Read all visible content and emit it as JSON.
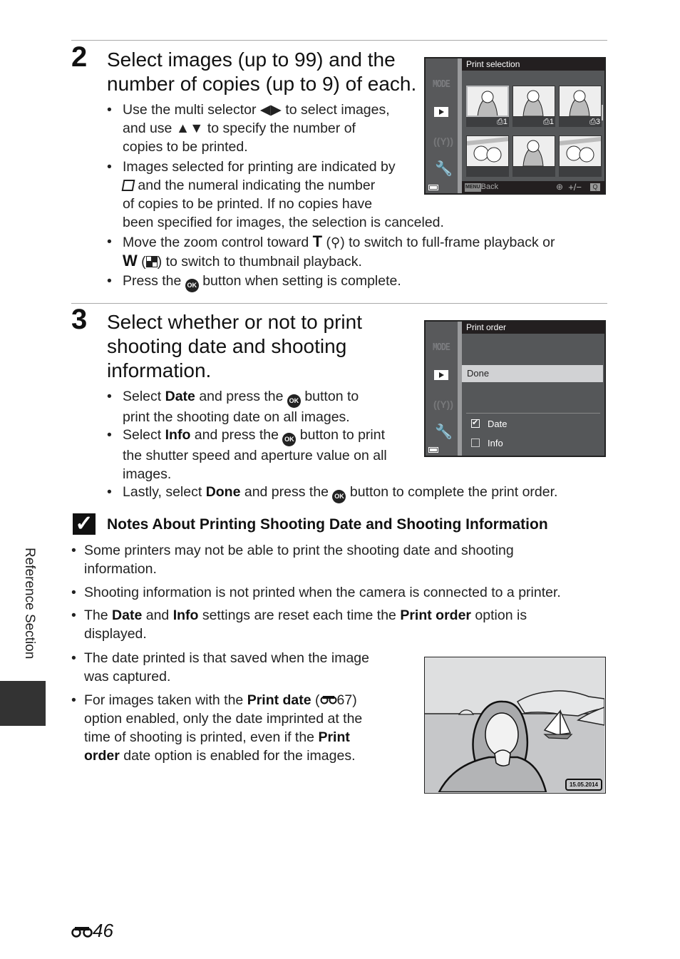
{
  "step2": {
    "number": "2",
    "title_line1": "Select images (up to 99) and the",
    "title_line2": "number of copies (up to 9) of each.",
    "bullets": {
      "b1_l1_a": "Use the multi selector ",
      "b1_l1_icon": "◀▶",
      "b1_l1_b": " to select images,",
      "b1_l2_a": "and use ",
      "b1_l2_icon": "▲▼",
      "b1_l2_b": " to specify the number of",
      "b1_l3": "copies to be printed.",
      "b2_l1": "Images selected for printing are indicated by",
      "b2_l2": " and the numeral indicating the number",
      "b2_l3": "of copies to be printed. If no copies have",
      "b2_l4": "been specified for images, the selection is canceled.",
      "b3_l1_a": "Move the zoom control toward ",
      "b3_l1_T": "T",
      "b3_l1_b": " (",
      "b3_l1_c": ") to switch to full-frame playback or",
      "b3_l2_W": "W",
      "b3_l2_a": " (",
      "b3_l2_b": ") to switch to thumbnail playback.",
      "b4_a": "Press the ",
      "b4_b": " button when setting is complete."
    }
  },
  "screen1": {
    "header": "Print selection",
    "mode_label": "MODE",
    "thumbnails": [
      {
        "label": "1",
        "selected": true
      },
      {
        "label": "1",
        "selected": false
      },
      {
        "label": "3",
        "selected": false
      },
      {
        "label": "",
        "selected": false
      },
      {
        "label": "",
        "selected": false
      },
      {
        "label": "",
        "selected": false
      }
    ],
    "footer_menu": "MENU",
    "footer_back": "Back",
    "footer_plusminus": "+/−"
  },
  "step3": {
    "number": "3",
    "title_line1": "Select whether or not to print",
    "title_line2": "shooting date and shooting",
    "title_line3": "information.",
    "bullets": {
      "b1_l1_a": "Select ",
      "b1_l1_bold": "Date",
      "b1_l1_b": " and press the ",
      "b1_l1_c": " button to",
      "b1_l2": "print the shooting date on all images.",
      "b2_l1_a": "Select ",
      "b2_l1_bold": "Info",
      "b2_l1_b": " and press the ",
      "b2_l1_c": " button to print",
      "b2_l2": "the shutter speed and aperture value on all",
      "b2_l3": "images.",
      "b3_a": "Lastly, select ",
      "b3_bold": "Done",
      "b3_b": " and press the ",
      "b3_c": " button to complete the print order."
    }
  },
  "screen2": {
    "header": "Print order",
    "mode_label": "MODE",
    "done_label": "Done",
    "options": [
      {
        "label": "Date",
        "checked": true
      },
      {
        "label": "Info",
        "checked": false
      }
    ]
  },
  "notes": {
    "icon": "✓",
    "title": "Notes About Printing Shooting Date and Shooting Information",
    "n1_l1": "Some printers may not be able to print the shooting date and shooting",
    "n1_l2": "information.",
    "n2": "Shooting information is not printed when the camera is connected to a printer.",
    "n3_a": "The ",
    "n3_bold1": "Date",
    "n3_b": " and ",
    "n3_bold2": "Info",
    "n3_c": " settings are reset each time the ",
    "n3_bold3": "Print order",
    "n3_d": " option is",
    "n3_l2": "displayed.",
    "n4_l1": "The date printed is that saved when the image",
    "n4_l2": "was captured.",
    "n5_l1_a": "For images taken with the ",
    "n5_l1_bold": "Print date",
    "n5_l1_b": " (",
    "n5_l1_ref": "67)",
    "n5_l2": "option enabled, only the date imprinted at the",
    "n5_l3_a": "time of shooting is printed, even if the ",
    "n5_l3_bold": "Print",
    "n5_l4_bold": "order",
    "n5_l4_b": " date option is enabled for the images."
  },
  "photo": {
    "date_stamp": "15.05.2014"
  },
  "sidebar": {
    "section_label": "Reference Section"
  },
  "page": {
    "number": "46",
    "ok_label": "OK"
  }
}
